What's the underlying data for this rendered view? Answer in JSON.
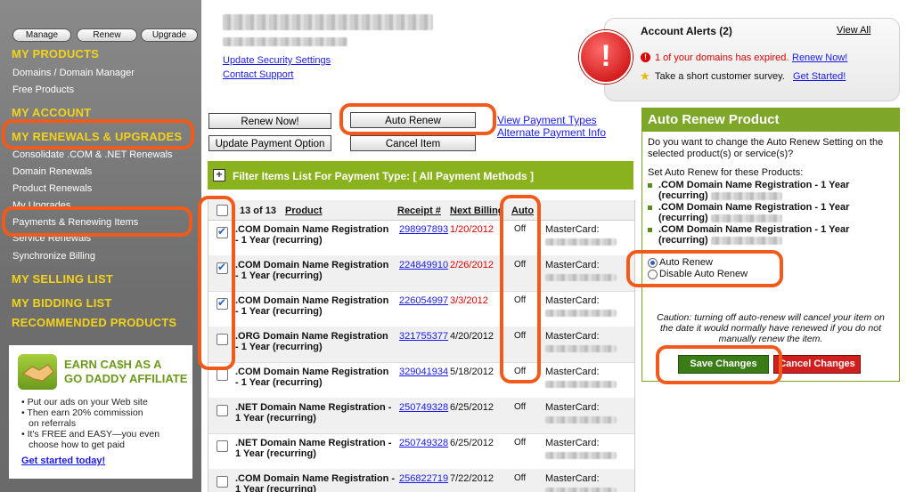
{
  "sidebar": {
    "buttons": [
      "Manage",
      "Renew",
      "Upgrade"
    ],
    "my_products": "MY PRODUCTS",
    "products_items": [
      "Domains / Domain Manager",
      "Free Products"
    ],
    "my_account": "MY ACCOUNT",
    "my_renewals": "MY RENEWALS & UPGRADES",
    "renewal_items": [
      "Consolidate .COM & .NET Renewals",
      "Domain Renewals",
      "Product Renewals",
      "My Upgrades",
      "Payments & Renewing Items",
      "Service Renewals",
      "Synchronize Billing"
    ],
    "my_selling": "MY SELLING LIST",
    "my_bidding": "MY BIDDING LIST",
    "recommended": "RECOMMENDED PRODUCTS"
  },
  "affiliate": {
    "title_1": "EARN CA$H AS A",
    "title_2": "GO DADDY AFFILIATE",
    "bullets": [
      "• Put our ads on your Web site",
      "• Then earn 20% commission",
      "   on referrals",
      "• It's FREE and EASY—you even",
      "   choose how to get paid"
    ],
    "cta": "Get started today!"
  },
  "header": {
    "security_link": "Update Security Settings",
    "support_link": "Contact Support"
  },
  "alerts": {
    "title": "Account Alerts (2)",
    "view_all": "View All",
    "alert1_text": "1 of your domains has expired.",
    "alert1_link": "Renew Now!",
    "alert2_text": "Take a short customer survey.",
    "alert2_link": "Get Started!"
  },
  "actions": {
    "renew_now": "Renew Now!",
    "auto_renew": "Auto Renew",
    "update_payment": "Update Payment Option",
    "cancel_item": "Cancel Item",
    "view_payment_types": "View Payment Types",
    "alternate_payment": "Alternate Payment Info"
  },
  "filter": {
    "label": "Filter Items List For Payment Type: [ All Payment Methods ]"
  },
  "table": {
    "count": "13 of 13",
    "headers": {
      "product": "Product",
      "receipt": "Receipt #",
      "billing": "Next Billing",
      "auto": "Auto"
    },
    "rows": [
      {
        "line1": ".COM Domain Name Registration",
        "line2": "- 1 Year (recurring)",
        "receipt": "298997893",
        "date": "1/20/2012",
        "auto": "Off",
        "card": "MasterCard:",
        "checked": true,
        "red": true
      },
      {
        "line1": ".COM Domain Name Registration",
        "line2": "- 1 Year (recurring)",
        "receipt": "224849910",
        "date": "2/26/2012",
        "auto": "Off",
        "card": "MasterCard:",
        "checked": true,
        "red": true
      },
      {
        "line1": ".COM Domain Name Registration",
        "line2": "- 1 Year (recurring)",
        "receipt": "226054997",
        "date": "3/3/2012",
        "auto": "Off",
        "card": "MasterCard:",
        "checked": true,
        "red": true
      },
      {
        "line1": ".ORG Domain Name Registration",
        "line2": "- 1 Year (recurring)",
        "receipt": "321755377",
        "date": "4/20/2012",
        "auto": "Off",
        "card": "MasterCard:",
        "checked": false,
        "red": false
      },
      {
        "line1": ".COM Domain Name Registration",
        "line2": "- 1 Year (recurring)",
        "receipt": "329041934",
        "date": "5/18/2012",
        "auto": "Off",
        "card": "MasterCard:",
        "checked": false,
        "red": false
      },
      {
        "line1": ".NET Domain Name Registration -",
        "line2": "1 Year (recurring)",
        "receipt": "250749328",
        "date": "6/25/2012",
        "auto": "Off",
        "card": "MasterCard:",
        "checked": false,
        "red": false
      },
      {
        "line1": ".NET Domain Name Registration -",
        "line2": "1 Year (recurring)",
        "receipt": "250749328",
        "date": "6/25/2012",
        "auto": "Off",
        "card": "MasterCard:",
        "checked": false,
        "red": false
      },
      {
        "line1": ".COM Domain Name Registration -",
        "line2": "1 Year (recurring)",
        "receipt": "256822719",
        "date": "7/22/2012",
        "auto": "Off",
        "card": "MasterCard:",
        "checked": false,
        "red": false
      }
    ]
  },
  "panel": {
    "title": "Auto Renew Product",
    "question": "Do you want to change the Auto Renew Setting on the selected product(s) or service(s)?",
    "set_label": "Set Auto Renew for these Products:",
    "items": [
      {
        "l1": ".COM Domain Name Registration - 1 Year",
        "l2": "(recurring)"
      },
      {
        "l1": ".COM Domain Name Registration - 1 Year",
        "l2": "(recurring)"
      },
      {
        "l1": ".COM Domain Name Registration - 1 Year",
        "l2": "(recurring)"
      }
    ],
    "radio_on": "Auto Renew",
    "radio_off": "Disable Auto Renew",
    "caution": "Caution: turning off auto-renew will cancel your item on the date it would normally have renewed if you do not manually renew the item.",
    "save": "Save Changes",
    "cancel": "Cancel Changes"
  },
  "colors": {
    "accent_orange": "#f25a1c",
    "brand_green": "#8ab21c",
    "sidebar_gold": "#f3d31a"
  }
}
